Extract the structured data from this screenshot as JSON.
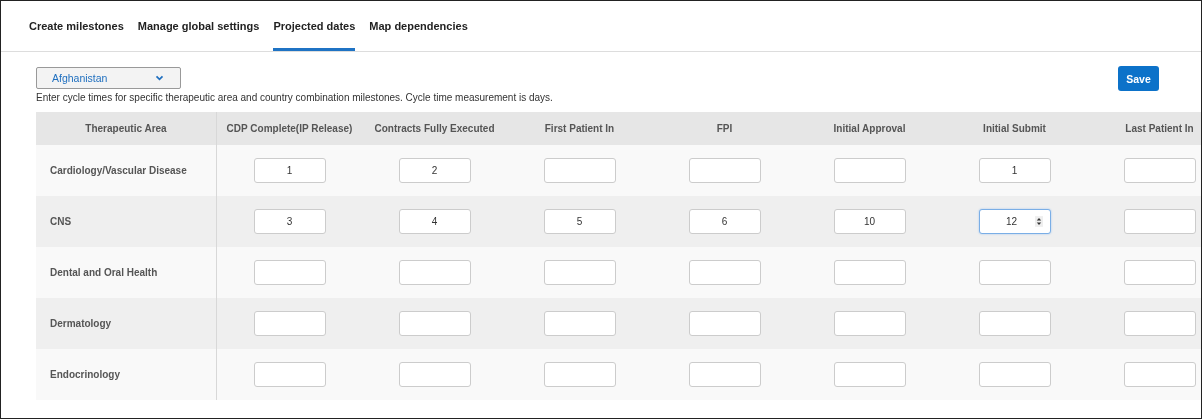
{
  "tabs": [
    {
      "label": "Create milestones",
      "selected": false
    },
    {
      "label": "Manage global settings",
      "selected": false
    },
    {
      "label": "Projected dates",
      "selected": true
    },
    {
      "label": "Map dependencies",
      "selected": false
    }
  ],
  "country_select": {
    "value": "Afghanistan"
  },
  "save_button": "Save",
  "description": "Enter cycle times for specific therapeutic area and country combination milestones. Cycle time measurement is days.",
  "table": {
    "columns": [
      "Therapeutic Area",
      "CDP Complete(IP Release)",
      "Contracts Fully Executed",
      "First Patient In",
      "FPI",
      "Initial Approval",
      "Initial Submit",
      "Last Patient In"
    ],
    "rows": [
      {
        "cells": [
          {
            "kind": "label",
            "text": "Cardiology/Vascular Disease"
          },
          {
            "kind": "number",
            "value": "1",
            "focused": false
          },
          {
            "kind": "number",
            "value": "2",
            "focused": false
          },
          {
            "kind": "number",
            "focused": false
          },
          {
            "kind": "number",
            "focused": false
          },
          {
            "kind": "number",
            "focused": false
          },
          {
            "kind": "number",
            "value": "1",
            "focused": false
          },
          {
            "kind": "number",
            "focused": false
          }
        ]
      },
      {
        "cells": [
          {
            "kind": "label",
            "text": "CNS"
          },
          {
            "kind": "number",
            "value": "3",
            "focused": false
          },
          {
            "kind": "number",
            "value": "4",
            "focused": false
          },
          {
            "kind": "number",
            "value": "5",
            "focused": false
          },
          {
            "kind": "number",
            "value": "6",
            "focused": false
          },
          {
            "kind": "number",
            "value": "10",
            "focused": false
          },
          {
            "kind": "number",
            "value": "12",
            "focused": true
          },
          {
            "kind": "number",
            "focused": false
          }
        ]
      },
      {
        "cells": [
          {
            "kind": "label",
            "text": "Dental and Oral Health"
          },
          {
            "kind": "number",
            "focused": false
          },
          {
            "kind": "number",
            "focused": false
          },
          {
            "kind": "number",
            "focused": false
          },
          {
            "kind": "number",
            "focused": false
          },
          {
            "kind": "number",
            "focused": false
          },
          {
            "kind": "number",
            "focused": false
          },
          {
            "kind": "number",
            "focused": false
          }
        ]
      },
      {
        "cells": [
          {
            "kind": "label",
            "text": "Dermatology"
          },
          {
            "kind": "number",
            "focused": false
          },
          {
            "kind": "number",
            "focused": false
          },
          {
            "kind": "number",
            "focused": false
          },
          {
            "kind": "number",
            "focused": false
          },
          {
            "kind": "number",
            "focused": false
          },
          {
            "kind": "number",
            "focused": false
          },
          {
            "kind": "number",
            "focused": false
          }
        ]
      },
      {
        "cells": [
          {
            "kind": "label",
            "text": "Endocrinology"
          },
          {
            "kind": "number",
            "focused": false
          },
          {
            "kind": "number",
            "focused": false
          },
          {
            "kind": "number",
            "focused": false
          },
          {
            "kind": "number",
            "focused": false
          },
          {
            "kind": "number",
            "focused": false
          },
          {
            "kind": "number",
            "focused": false
          },
          {
            "kind": "number",
            "focused": false
          }
        ]
      }
    ]
  }
}
